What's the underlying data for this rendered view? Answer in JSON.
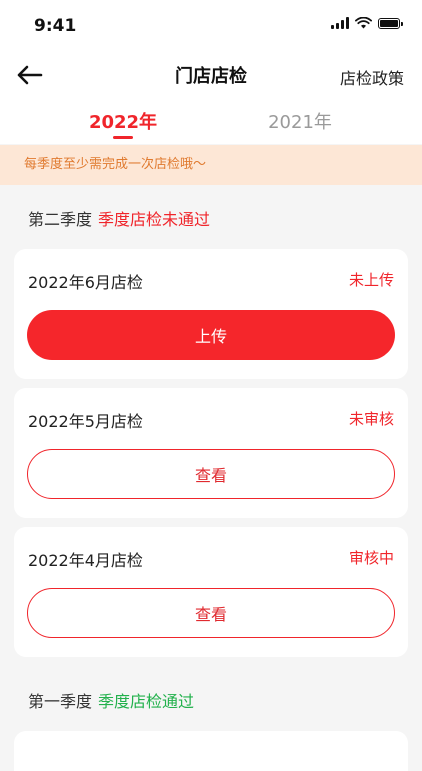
{
  "status_bar": {
    "time": "9:41"
  },
  "nav": {
    "title": "门店店检",
    "right_link": "店检政策"
  },
  "tabs": [
    {
      "label": "2022年"
    },
    {
      "label": "2021年"
    }
  ],
  "notice": "每季度至少需完成一次店检哦～",
  "sections": [
    {
      "title": "第二季度",
      "status": "季度店检未通过",
      "cards": [
        {
          "title": "2022年6月店检",
          "status": "未上传",
          "button": "上传"
        },
        {
          "title": "2022年5月店检",
          "status": "未审核",
          "button": "查看"
        },
        {
          "title": "2022年4月店检",
          "status": "审核中",
          "button": "查看"
        }
      ]
    },
    {
      "title": "第一季度",
      "status": "季度店检通过"
    }
  ],
  "colors": {
    "accent": "#f0252b",
    "pass": "#22b14c",
    "notice_bg": "#fde7d6",
    "notice_text": "#e07a2f"
  }
}
